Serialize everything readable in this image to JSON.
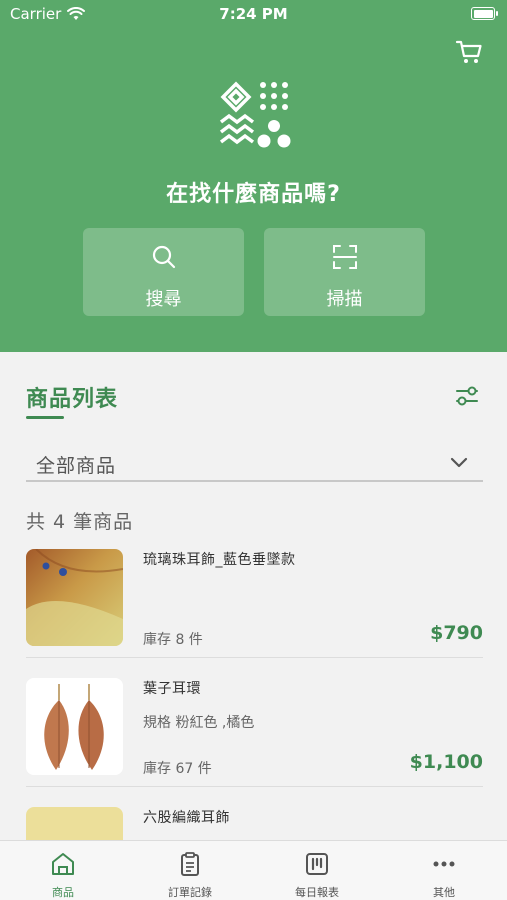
{
  "status": {
    "carrier": "Carrier",
    "time": "7:24 PM"
  },
  "header": {
    "question": "在找什麼商品嗎?",
    "search_label": "搜尋",
    "scan_label": "掃描"
  },
  "products": {
    "section_title": "商品列表",
    "filter_value": "全部商品",
    "count_text": "共 4 筆商品",
    "items": [
      {
        "name": "琉璃珠耳飾_藍色垂墜款",
        "spec": "",
        "stock": "庫存  8 件",
        "price": "$790"
      },
      {
        "name": "葉子耳環",
        "spec": "規格 粉紅色 ,橘色",
        "stock": "庫存  67 件",
        "price": "$1,100"
      },
      {
        "name": "六股編織耳飾",
        "spec": "",
        "stock": "",
        "price": ""
      }
    ]
  },
  "tabbar": {
    "tabs": [
      {
        "label": "商品"
      },
      {
        "label": "訂單記錄"
      },
      {
        "label": "每日報表"
      },
      {
        "label": "其他"
      }
    ]
  },
  "colors": {
    "header_green": "#5aa96a",
    "accent_green": "#3f8a52"
  },
  "icons": [
    "wifi-icon",
    "battery-icon",
    "cart-icon",
    "brand-logo",
    "search-icon",
    "scan-icon",
    "filter-icon",
    "chevron-down-icon",
    "home-icon",
    "clipboard-icon",
    "report-icon",
    "more-icon"
  ]
}
